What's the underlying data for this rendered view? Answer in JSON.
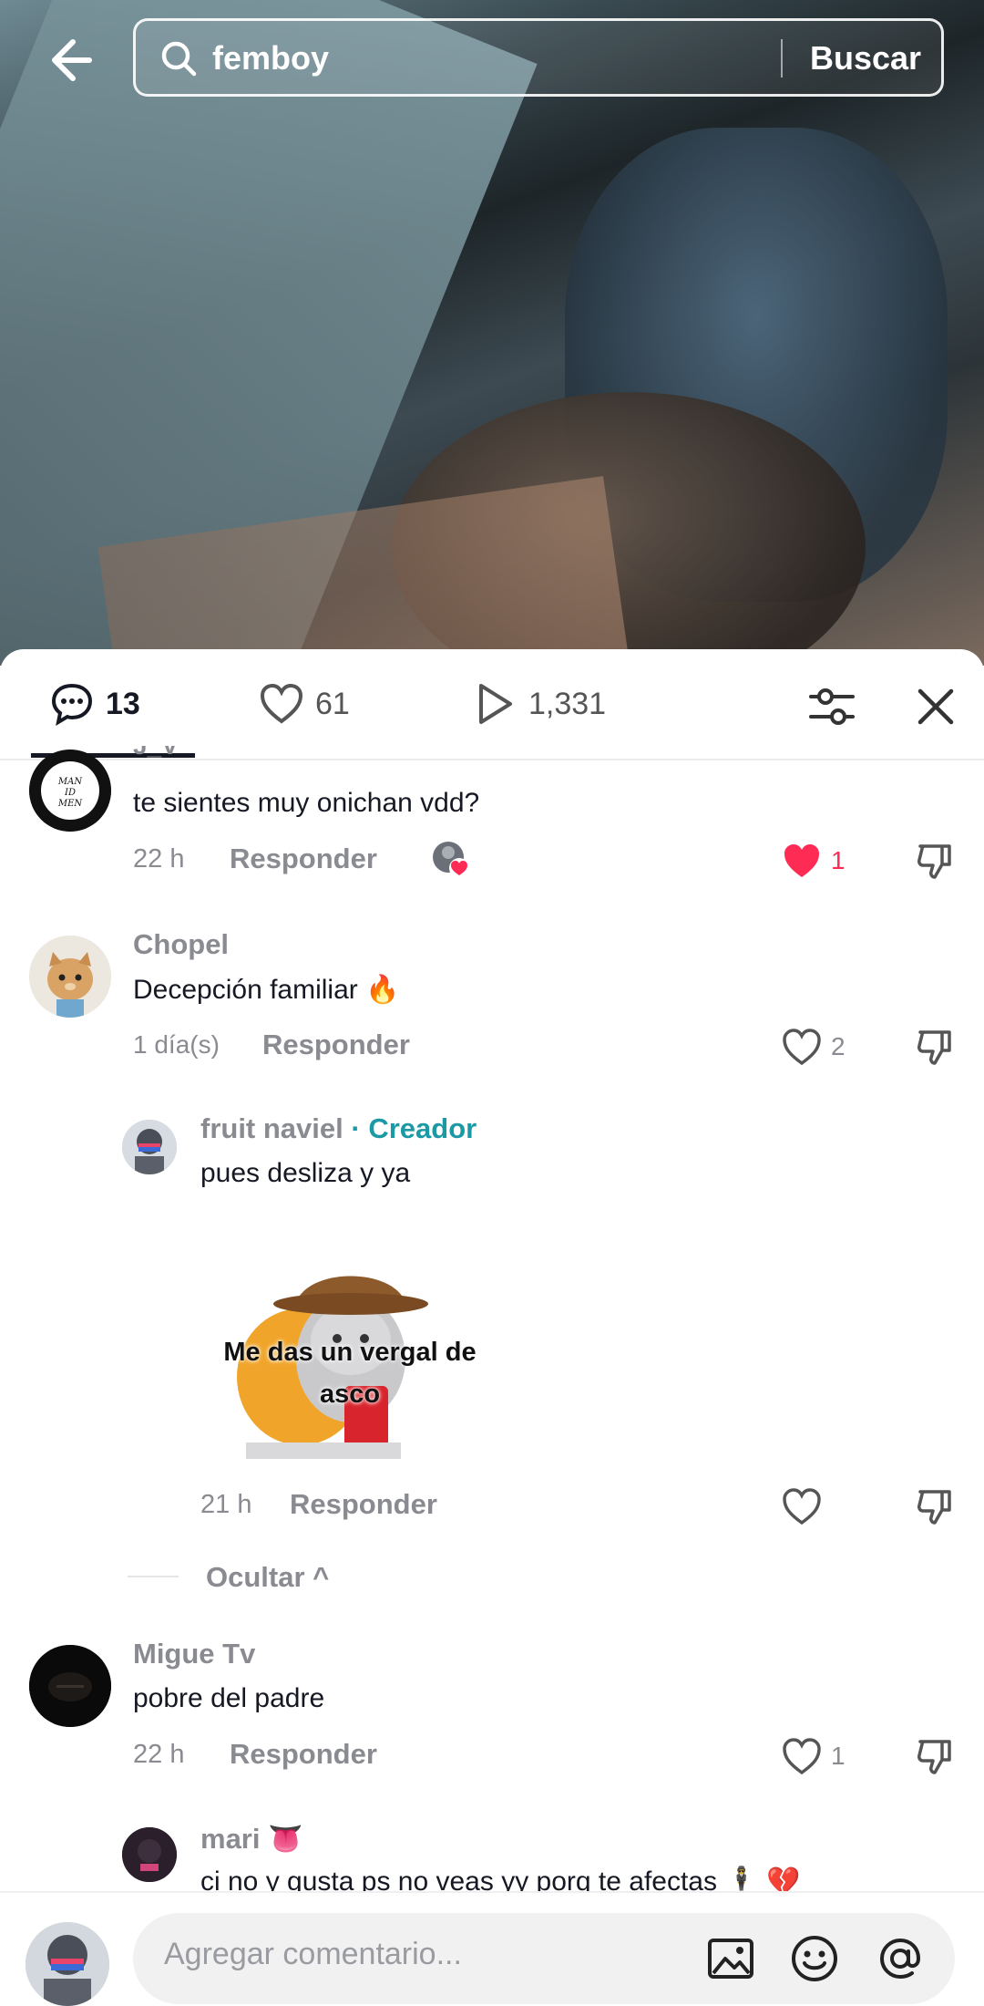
{
  "search": {
    "query": "femboy",
    "submit_label": "Buscar"
  },
  "stats": {
    "comments": "13",
    "likes": "61",
    "plays": "1,331"
  },
  "comments": [
    {
      "username": "J_V",
      "avatar_text": "MAN ID MEN",
      "text": "te sientes muy onichan vdd?",
      "time": "22 h",
      "reply_label": "Responder",
      "likes": "1",
      "liked_by_creator": true
    },
    {
      "username": "Chopel",
      "text": "Decepción familiar 🔥",
      "time": "1 día(s)",
      "reply_label": "Responder",
      "likes": "2"
    },
    {
      "username": "fruit naviel",
      "creator_label": "· Creador",
      "text": "pues desliza y ya",
      "sticker_text": "Me das un vergal de asco",
      "time": "21 h",
      "reply_label": "Responder",
      "likes": ""
    },
    {
      "username": "Migue Tv",
      "text": "pobre del padre",
      "time": "22 h",
      "reply_label": "Responder",
      "likes": "1"
    },
    {
      "username": "mari 👅",
      "text": "ci no y gusta ps no veas yy porq te afectas 🕴 💔"
    }
  ],
  "hide_label": "Ocultar ^",
  "input": {
    "placeholder": "Agregar comentario..."
  },
  "colors": {
    "accent_red": "#fe2c55",
    "creator_teal": "#1b9aa6",
    "muted": "#8a8b91"
  }
}
